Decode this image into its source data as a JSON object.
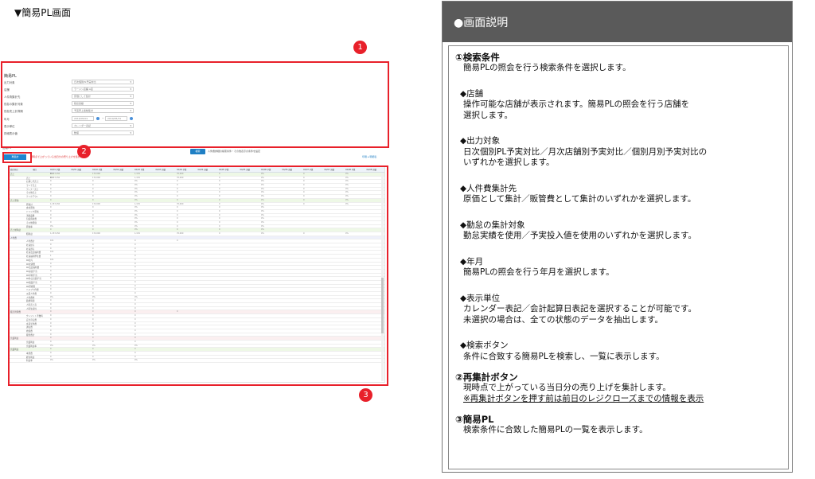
{
  "page_heading": "▼簡易PL画面",
  "badges": [
    "1",
    "2",
    "3"
  ],
  "mock": {
    "form_title": "簡易PL",
    "fields": [
      {
        "label": "出力対象",
        "value": "日次個別PL予実対比"
      },
      {
        "label": "店舗",
        "value": "ラーメン店舗 A店"
      },
      {
        "label": "人件費集計先",
        "value": "原価として集計"
      },
      {
        "label": "勤怠の集計対象",
        "value": "勤怠実績"
      },
      {
        "label": "勤怠売上計算期",
        "value": "予実売上連動集計"
      },
      {
        "label": "年月",
        "value": ""
      },
      {
        "label": "表示単位",
        "value": "カレンダー表記"
      },
      {
        "label": "詳細表示値",
        "value": "数値"
      }
    ],
    "date_from": "2019/05/01",
    "date_to": "2019/05/31",
    "date_sep": "~",
    "search_button": "検索",
    "search_note": "人件費詳細の検索条件・その他表示の条件を設定",
    "list_caption": "簡易PL",
    "recalc_button": "再集計",
    "recalc_note": "現時点で上がっている当日分の売り上げを集計します",
    "export_links": "印刷  ▸ 明細表",
    "table": {
      "header": [
        "勘定科目",
        "項目",
        "04/01 予算",
        "04/01 実績",
        "04/02 予算",
        "04/02 実績",
        "04/03 予算",
        "04/03 実績",
        "04/04 予算",
        "04/04 実績",
        "04/05 予算",
        "04/05 実績",
        "04/06 予算",
        "04/06 実績",
        "04/07 予算",
        "04/07 実績",
        "04/08 予算",
        "04/08 実績"
      ],
      "rows": [
        {
          "label": "売上",
          "tone": "green",
          "vals": [
            "1,153,150",
            "172,000",
            "1,154",
            "70,000",
            "0",
            "0%",
            "0",
            "0%",
            "0",
            "0%"
          ]
        },
        {
          "label": "売上",
          "tone": "",
          "vals": [
            "1,153,150",
            "172,000",
            "1,154",
            "70,000",
            "0",
            "0%",
            "0",
            "0%",
            "0",
            "0%"
          ]
        },
        {
          "label": "お通し代売上",
          "tone": "",
          "vals": [
            "0",
            "0",
            "0%",
            "0",
            "0",
            "0%",
            "0",
            "0%"
          ]
        },
        {
          "label": "ランチ売上",
          "tone": "",
          "vals": [
            "0",
            "0",
            "0%",
            "0",
            "0",
            "0%",
            "0",
            "0%"
          ]
        },
        {
          "label": "ディナー売上",
          "tone": "",
          "vals": [
            "0",
            "0",
            "0%",
            "0",
            "0",
            "0%",
            "0",
            "0%"
          ]
        },
        {
          "label": "その他売上",
          "tone": "",
          "vals": [
            "0",
            "0",
            "0%",
            "0",
            "0",
            "0%",
            "0",
            "0%"
          ]
        },
        {
          "label": "テイクアウト",
          "tone": "",
          "vals": [
            "0",
            "0",
            "0%",
            "0",
            "0",
            "0%",
            "0",
            "0%"
          ]
        },
        {
          "label": "売上原価",
          "tone": "green",
          "vals": [
            "0",
            "0",
            "0%",
            "0",
            "0",
            "0%",
            "0",
            "0%"
          ]
        },
        {
          "label": "原価計",
          "tone": "",
          "vals": [
            "1,153,150",
            "172,000",
            "1,154",
            "70,000",
            "0",
            "0%",
            "0",
            "0%"
          ]
        },
        {
          "label": "食材原価",
          "tone": "",
          "vals": [
            "0",
            "0",
            "0%",
            "0",
            "0",
            "0%"
          ]
        },
        {
          "label": "ドリンク原価",
          "tone": "",
          "vals": [
            "0",
            "0",
            "0%",
            "0",
            "0",
            "0%"
          ]
        },
        {
          "label": "消耗品費",
          "tone": "",
          "vals": [
            "0",
            "0",
            "0%",
            "0",
            "0",
            "0%"
          ]
        },
        {
          "label": "包装資材費",
          "tone": "",
          "vals": [
            "0",
            "0",
            "0%",
            "0",
            "0",
            "0%"
          ]
        },
        {
          "label": "その他原価",
          "tone": "",
          "vals": [
            "0",
            "0",
            "0%",
            "0",
            "0",
            "0%"
          ]
        },
        {
          "label": "原価率",
          "tone": "",
          "vals": [
            "0%",
            "0",
            "0%",
            "0",
            "0",
            "0%"
          ]
        },
        {
          "label": "売上総利益",
          "tone": "green",
          "vals": [
            "0",
            "0",
            "0%",
            "0",
            "0",
            "0%"
          ]
        },
        {
          "label": "粗利益",
          "tone": "",
          "vals": [
            "1,153,150",
            "172,000",
            "1,154",
            "70,000",
            "0",
            "0%",
            "0",
            "0%"
          ]
        },
        {
          "label": "人件費",
          "tone": "blue",
          "vals": []
        },
        {
          "label": "人件費計",
          "tone": "",
          "vals": [
            "101",
            "0",
            "0",
            "0"
          ]
        },
        {
          "label": "社員給与",
          "tone": "",
          "vals": [
            "0",
            "0",
            "0"
          ]
        },
        {
          "label": "社員賞与",
          "tone": "",
          "vals": [
            "0",
            "0",
            "0"
          ]
        },
        {
          "label": "社員法定福利費",
          "tone": "",
          "vals": [
            "101",
            "0",
            "0"
          ]
        },
        {
          "label": "社員福利厚生費",
          "tone": "",
          "vals": [
            "1",
            "0",
            "0"
          ]
        },
        {
          "label": "PA給与",
          "tone": "",
          "vals": [
            "101",
            "0",
            "0"
          ]
        },
        {
          "label": "PA交通費",
          "tone": "",
          "vals": [
            "0",
            "0",
            "0"
          ]
        },
        {
          "label": "PA法定福利費",
          "tone": "",
          "vals": [
            "0",
            "0",
            "0"
          ]
        },
        {
          "label": "PA深夜手当",
          "tone": "",
          "vals": [
            "0",
            "0",
            "0"
          ]
        },
        {
          "label": "PA早朝手当",
          "tone": "",
          "vals": [
            "0",
            "0",
            "0"
          ]
        },
        {
          "label": "PA休日出勤手当",
          "tone": "",
          "vals": [
            "0",
            "0",
            "0"
          ]
        },
        {
          "label": "PA残業手当",
          "tone": "",
          "vals": [
            "0",
            "0",
            "0"
          ]
        },
        {
          "label": "PA研修費",
          "tone": "",
          "vals": [
            "0",
            "0",
            "0"
          ]
        },
        {
          "label": "ヘルプ人件費",
          "tone": "",
          "vals": [
            "0",
            "0",
            "0"
          ]
        },
        {
          "label": "派遣人件費",
          "tone": "",
          "vals": [
            "0",
            "0",
            "0"
          ]
        },
        {
          "label": "人件費率",
          "tone": "",
          "vals": [
            "0%",
            "0%",
            "0%"
          ]
        },
        {
          "label": "勤務時間",
          "tone": "",
          "vals": [
            "0",
            "0",
            "0"
          ]
        },
        {
          "label": "人時売上高",
          "tone": "",
          "vals": [
            "0",
            "0",
            "0"
          ]
        },
        {
          "label": "人時生産性",
          "tone": "",
          "vals": [
            "0",
            "0",
            "0"
          ]
        },
        {
          "label": "販売管理費",
          "tone": "pink",
          "vals": [
            "0",
            "0",
            "0",
            "0"
          ]
        },
        {
          "label": "クレジット手数料",
          "tone": "",
          "vals": [
            "0",
            "0",
            "0"
          ]
        },
        {
          "label": "広告宣伝費",
          "tone": "",
          "vals": [
            "0",
            "0",
            "0"
          ]
        },
        {
          "label": "水道光熱費",
          "tone": "",
          "vals": [
            "0",
            "0",
            "0"
          ]
        },
        {
          "label": "通信費",
          "tone": "",
          "vals": [
            "0",
            "0",
            "0"
          ]
        },
        {
          "label": "修繕費",
          "tone": "",
          "vals": [
            "0",
            "0",
            "0"
          ]
        },
        {
          "label": "販管費計",
          "tone": "",
          "vals": [
            "0",
            "0",
            "0"
          ]
        },
        {
          "label": "営業利益",
          "tone": "pink",
          "vals": [
            "0",
            "0",
            "0"
          ]
        },
        {
          "label": "営業利益",
          "tone": "",
          "vals": [
            "0",
            "0",
            "0"
          ]
        },
        {
          "label": "営業利益率",
          "tone": "",
          "vals": [
            "0%",
            "0%",
            "0%"
          ]
        },
        {
          "label": "営業利益",
          "tone": "green",
          "vals": [
            "0",
            "0",
            "0"
          ]
        },
        {
          "label": "本部費",
          "tone": "",
          "vals": [
            "0",
            "0",
            "0"
          ]
        },
        {
          "label": "経常利益",
          "tone": "",
          "vals": [
            "0",
            "0",
            "0"
          ]
        },
        {
          "label": "利益率",
          "tone": "",
          "vals": [
            "0%",
            "0%",
            "0%"
          ]
        }
      ]
    }
  },
  "panel": {
    "title": "●画面説明",
    "s1_heading": "①検索条件",
    "s1_text": "簡易PLの照会を行う検索条件を選択します。",
    "store_title": "◆店舗",
    "store_text1": "操作可能な店舗が表示されます。簡易PLの照会を行う店舗を",
    "store_text2": "選択します。",
    "output_title": "◆出力対象",
    "output_text1": "日次個別PL予実対比／月次店舗別予実対比／個別月別予実対比の",
    "output_text2": "いずれかを選択します。",
    "labor_title": "◆人件費集計先",
    "labor_text": "原価として集計／販管費として集計のいずれかを選択します。",
    "attend_title": "◆勤怠の集計対象",
    "attend_text": "勤怠実績を使用／予実投入値を使用のいずれかを選択します。",
    "ym_title": "◆年月",
    "ym_text": "簡易PLの照会を行う年月を選択します。",
    "unit_title": "◆表示単位",
    "unit_text1": "カレンダー表記／会計起算日表記を選択することが可能です。",
    "unit_text2": "未選択の場合は、全ての状態のデータを抽出します。",
    "btn_title": "◆検索ボタン",
    "btn_text": "条件に合致する簡易PLを検索し、一覧に表示します。",
    "s2_heading": "②再集計ボタン",
    "s2_text1": "現時点で上がっている当日分の売り上げを集計します。",
    "s2_text2": "※再集計ボタンを押す前は前日のレジクローズまでの情報を表示",
    "s3_heading": "③簡易PL",
    "s3_text": "検索条件に合致した簡易PLの一覧を表示します。"
  },
  "colors": {
    "highlight": "#e8202a",
    "panel_header": "#5a5a5a",
    "button_blue": "#1f7fc4"
  }
}
